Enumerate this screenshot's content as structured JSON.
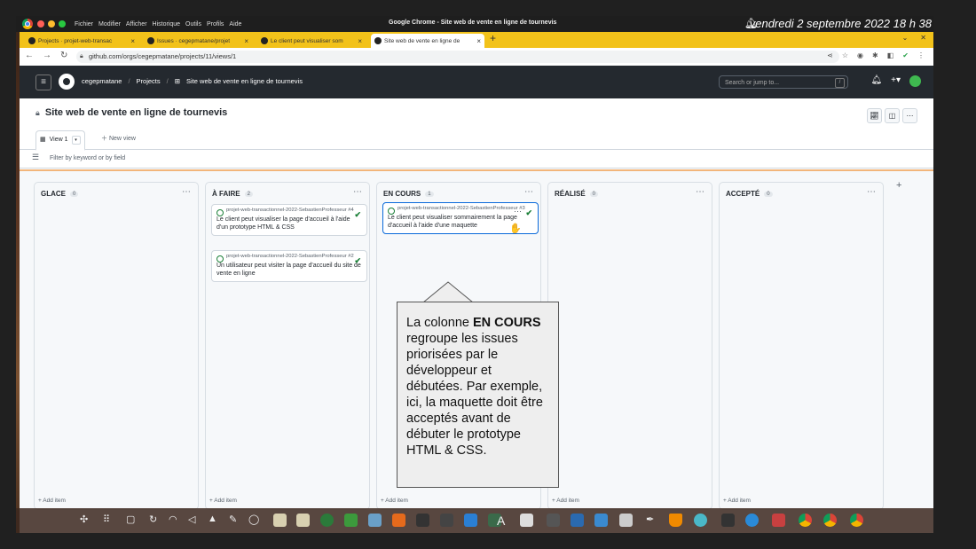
{
  "menubar": {
    "menus": [
      "Fichier",
      "Modifier",
      "Afficher",
      "Historique",
      "Outils",
      "Profils",
      "Aide"
    ],
    "window_title": "Google Chrome - Site web de vente en ligne de tournevis",
    "datetime": "vendredi 2 septembre 2022  18 h 38"
  },
  "tabs": [
    {
      "label": "Projects · projet-web-transac"
    },
    {
      "label": "Issues · cegepmatane/projet"
    },
    {
      "label": "Le client peut visualiser som"
    },
    {
      "label": "Site web de vente en ligne de"
    }
  ],
  "address": {
    "url": "github.com/orgs/cegepmatane/projects/11/views/1"
  },
  "github": {
    "org": "cegepmatane",
    "projects": "Projects",
    "project_name": "Site web de vente en ligne de tournevis",
    "search_placeholder": "Search or jump to...",
    "search_key": "/"
  },
  "project": {
    "title": "Site web de vente en ligne de tournevis",
    "view_label": "View 1",
    "new_view": "New view",
    "filter_placeholder": "Filter by keyword or by field"
  },
  "columns": [
    {
      "name": "GLACE",
      "count": "0",
      "add": "Add item",
      "cards": []
    },
    {
      "name": "À FAIRE",
      "count": "2",
      "add": "Add item",
      "cards": [
        {
          "repo": "projet-web-transactionnel-2022-SebastienProfesseur #4",
          "title": "Le client peut visualiser la page d'accueil à l'aide d'un prototype HTML & CSS"
        },
        {
          "repo": "projet-web-transactionnel-2022-SebastienProfesseur #2",
          "title": "Un utilisateur peut visiter la page d'accueil du site de vente en ligne"
        }
      ]
    },
    {
      "name": "EN COURS",
      "count": "1",
      "add": "Add item",
      "cards": [
        {
          "repo": "projet-web-transactionnel-2022-SebastienProfesseur #3",
          "title": "Le client peut visualiser sommairement la page d'accueil à l'aide d'une maquette"
        }
      ]
    },
    {
      "name": "RÉALISÉ",
      "count": "0",
      "add": "Add item",
      "cards": []
    },
    {
      "name": "ACCEPTÉ",
      "count": "0",
      "add": "Add item",
      "cards": []
    }
  ],
  "callout": {
    "before": "La colonne ",
    "bold": "EN COURS",
    "after": " regroupe les issues priorisées par le développeur et débutées.  Par exemple, ici, la maquette doit être acceptés avant de débuter le prototype HTML & CSS."
  },
  "colors": {
    "accent": "#0969da",
    "tabstrip": "#f2c21a",
    "header": "#24292f",
    "open_issue": "#1a7f37"
  }
}
